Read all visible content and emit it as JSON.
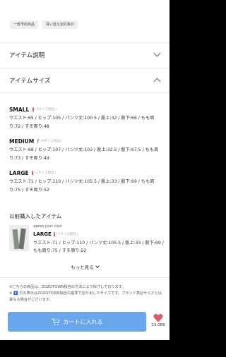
{
  "tags": [
    "一部予約商品",
    "買い替え割対象外"
  ],
  "sections": {
    "item_description": "アイテム説明",
    "item_size": "アイテムサイズ"
  },
  "sizes": [
    {
      "name": "SMALL",
      "ref": "Sサイズ相当",
      "measurements": "ウエスト:65 / ヒップ:105 / パンツ丈:100.5 / 股上:32 / 股下:66 / もも周り:72 / すそ周り:48"
    },
    {
      "name": "MEDIUM",
      "ref": "Mサイズ相当",
      "measurements": "ウエスト:68 / ヒップ:107 / パンツ丈:103 / 股上:32.5 / 股下:67.5 / もも周り:73 / すそ周り:49"
    },
    {
      "name": "LARGE",
      "ref": "Lサイズ相当",
      "measurements": "ウエスト:71 / ヒップ:110 / パンツ丈:105.5 / 股上:33 / 股下:69 / もも周り:75 / すそ周り:52"
    }
  ],
  "previous": {
    "title": "以前購入したアイテム",
    "brand": "apres jour clair",
    "size": "LARGE",
    "ref": "Lサイズ相当",
    "measurements": "ウエスト:71 / ヒップ:110 / パンツ丈:105.5 / 股上:33 / 股下:69 / もも周り:75 / すそ周り:52"
  },
  "more_label": "もっと見る",
  "notes": [
    "※こちらの商品は、ZOZOTOWN独自の方法により採寸しております。",
    "※ 🚹 方の表示はZOZOTOWN独自の基準で割り出したサイズです。ブランド表記サイズとは異なる場合がございます。"
  ],
  "cart_label": "カートに入れる",
  "favorite_count": "13,086",
  "colors": {
    "cart": "#6ba6ea",
    "heart": "#e05a6d"
  }
}
